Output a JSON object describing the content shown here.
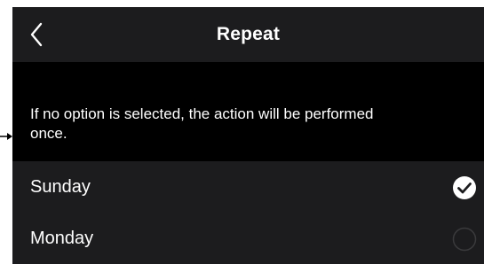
{
  "header": {
    "title": "Repeat",
    "back_icon": "chevron-left-icon"
  },
  "info": {
    "text": "If no option is selected, the action will be performed once."
  },
  "days": [
    {
      "label": "Sunday",
      "selected": true
    },
    {
      "label": "Monday",
      "selected": false
    }
  ],
  "colors": {
    "nav_background": "#1c1c1e",
    "screen_background": "#000000",
    "text": "#ffffff",
    "check_fill": "#ffffff",
    "unselected_ring": "#3a3a3c"
  }
}
